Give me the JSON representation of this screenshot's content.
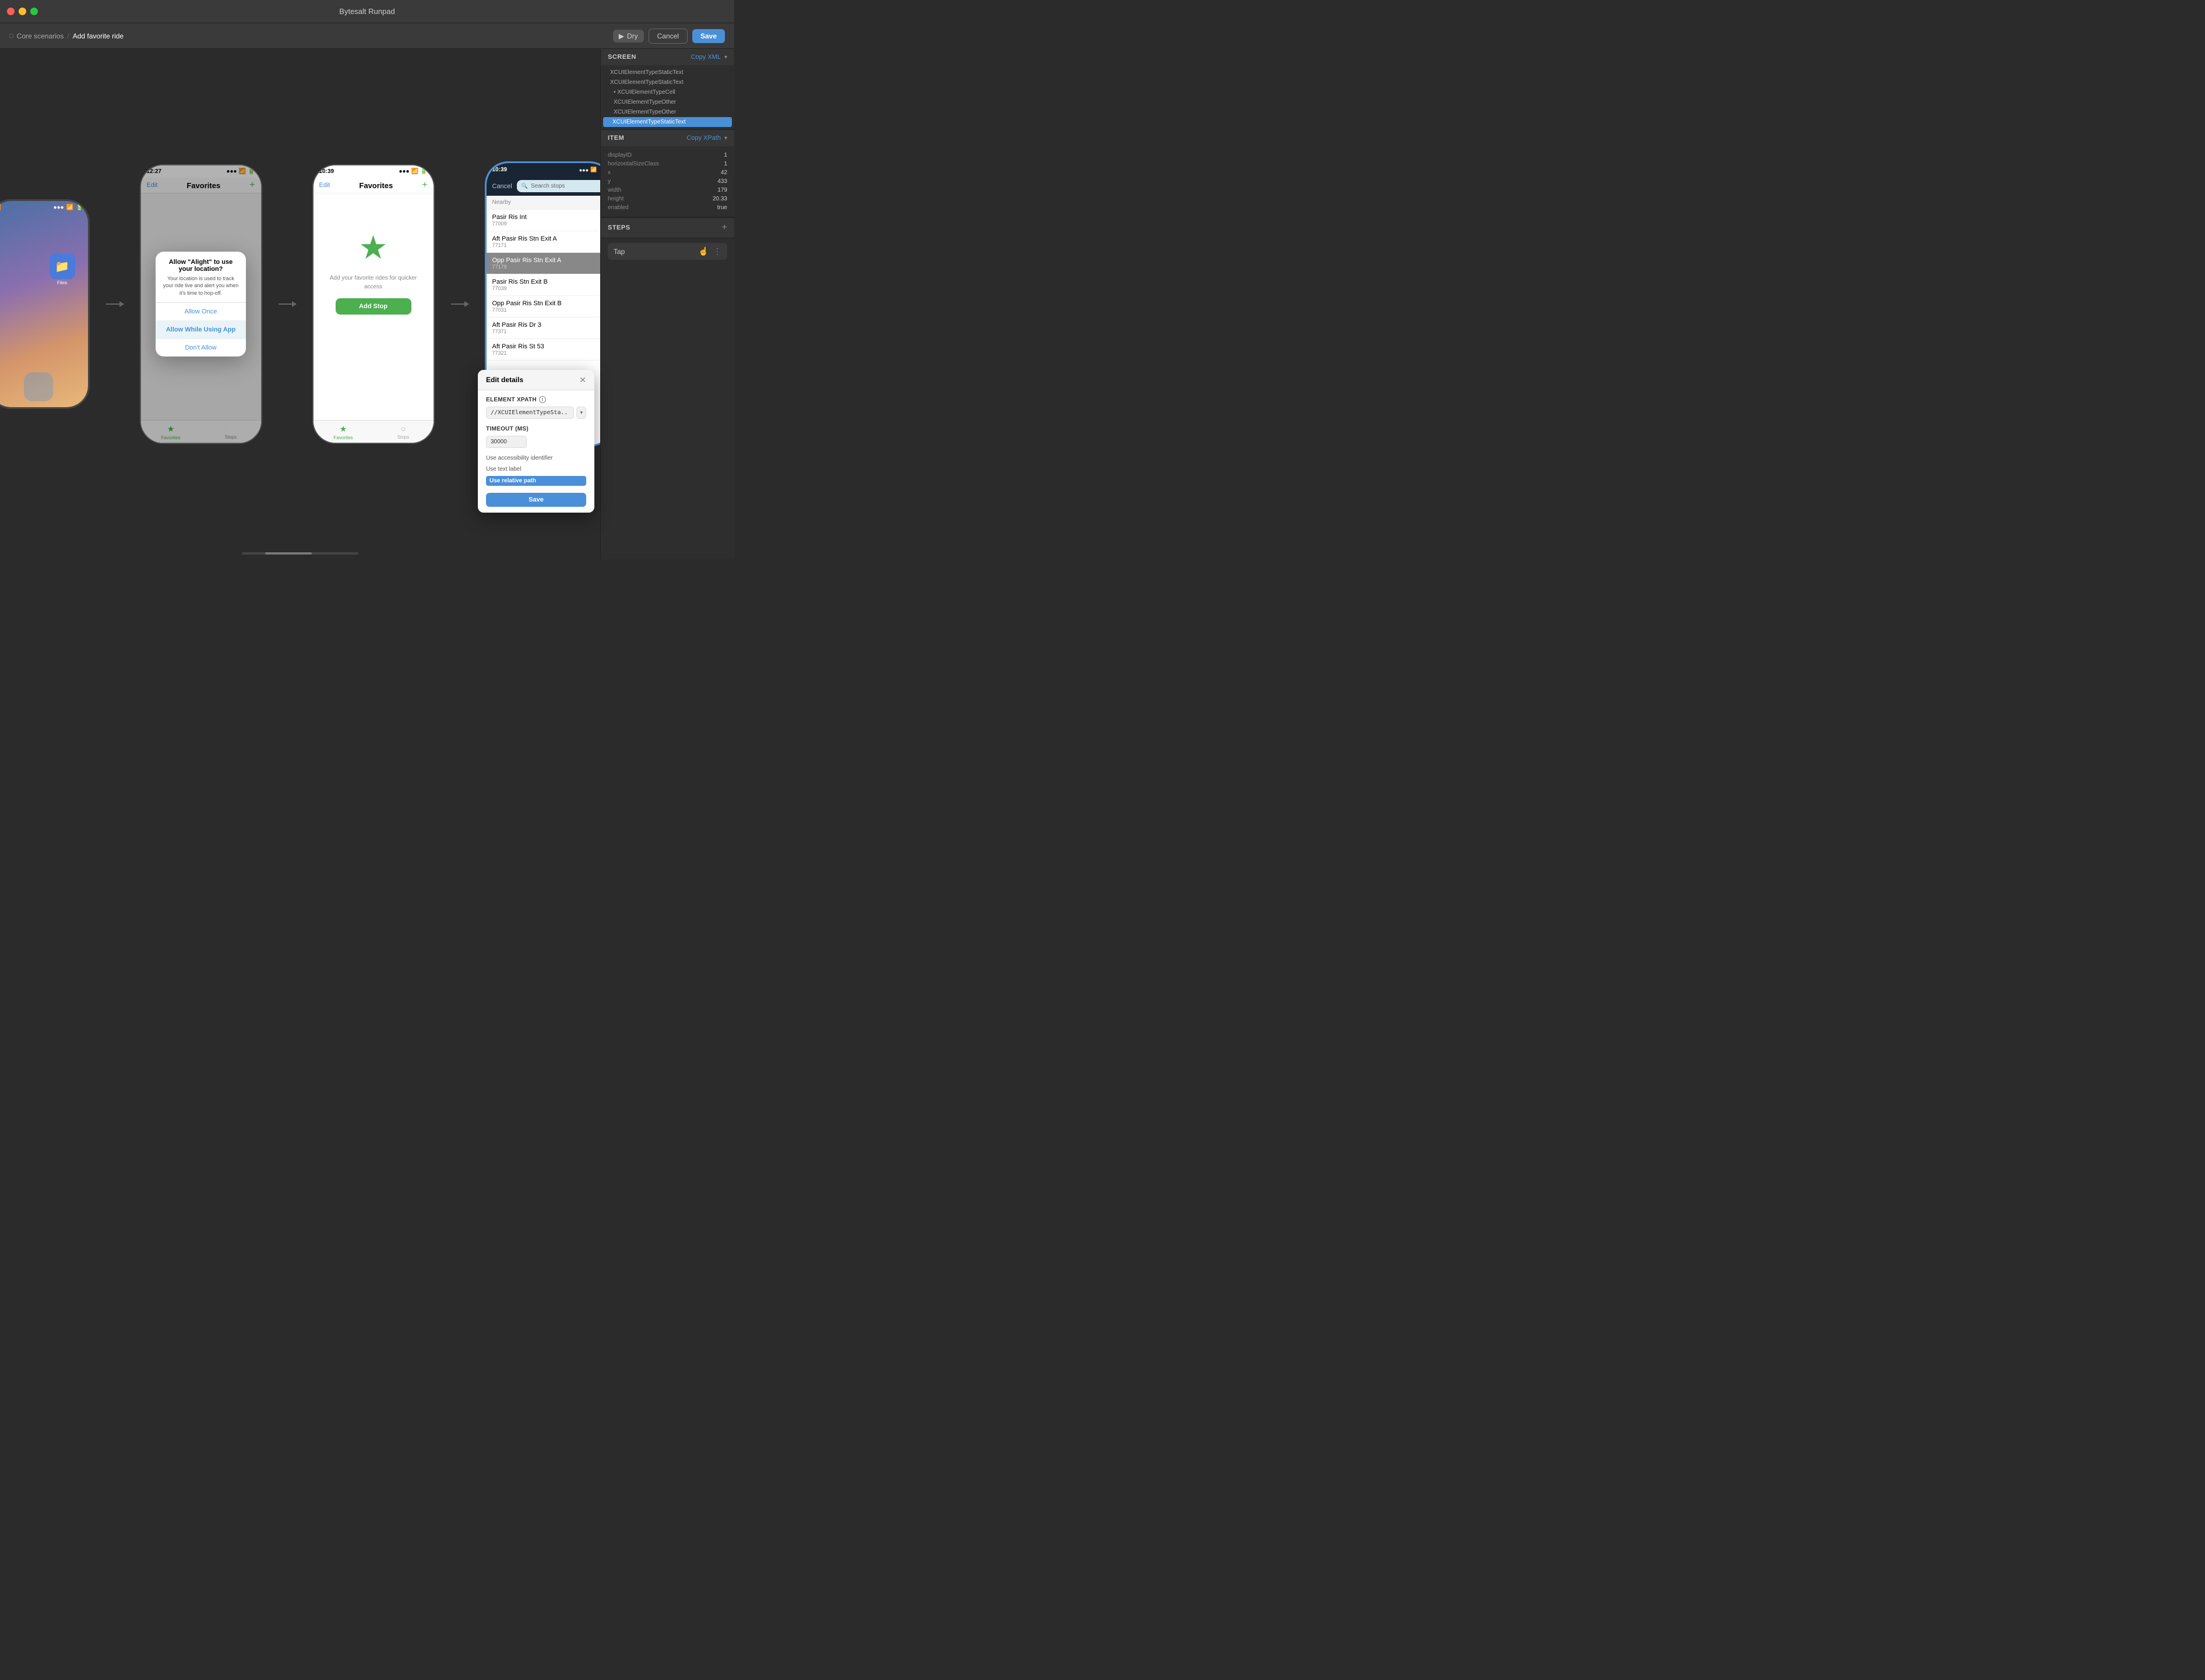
{
  "app": {
    "title": "Bytesalt Runpad"
  },
  "titlebar": {
    "title": "Bytesalt Runpad"
  },
  "toolbar": {
    "breadcrumb_parent": "Core scenarios",
    "breadcrumb_separator": "/",
    "breadcrumb_current": "Add favorite ride",
    "dry_label": "Dry",
    "cancel_label": "Cancel",
    "save_label": "Save"
  },
  "right_panel": {
    "screen_section": {
      "title": "SCREEN",
      "copy_xml_label": "Copy XML",
      "tree_items": [
        {
          "label": "XCUIElementTypeStaticText",
          "level": 0,
          "active": false
        },
        {
          "label": "XCUIElementTypeStaticText",
          "level": 0,
          "active": false
        },
        {
          "label": "• XCUIElementTypeCell",
          "level": 1,
          "active": false
        },
        {
          "label": "XCUIElementTypeOther",
          "level": 1,
          "active": false
        },
        {
          "label": "XCUIElementTypeOther",
          "level": 1,
          "active": false
        },
        {
          "label": "XCUIElementTypeStaticText",
          "level": 0,
          "active": true
        }
      ]
    },
    "item_section": {
      "title": "ITEM",
      "copy_xpath_label": "Copy XPath",
      "fields": [
        {
          "label": "displayID",
          "value": "1"
        },
        {
          "label": "horizontalSizeClass",
          "value": "1"
        },
        {
          "label": "x",
          "value": "42"
        },
        {
          "label": "y",
          "value": "433"
        },
        {
          "label": "width",
          "value": "179"
        },
        {
          "label": "height",
          "value": "20.33"
        },
        {
          "label": "enabled",
          "value": "true"
        }
      ]
    },
    "steps_section": {
      "title": "STEPS",
      "step_label": "Tap"
    }
  },
  "edit_details": {
    "title": "Edit details",
    "element_xpath_label": "ELEMENT XPATH",
    "xpath_value": "//XCUIElementTypeSta...",
    "timeout_label": "TIMEOUT (MS)",
    "timeout_value": "30000",
    "path_options": [
      {
        "label": "Use accessibility identifier",
        "active": false
      },
      {
        "label": "Use text label",
        "active": false
      },
      {
        "label": "Use relative path",
        "active": true
      }
    ],
    "save_label": "Save"
  },
  "phones": {
    "phone1": {
      "type": "home_screen",
      "app_icon": "📁",
      "app_label": "Files"
    },
    "phone2": {
      "type": "dialog",
      "time": "12:27",
      "nav_title": "Favorites",
      "nav_edit": "Edit",
      "nav_add": "+",
      "dialog_title": "Allow \"Alight\" to use your location?",
      "dialog_body": "Your location is used to track your ride live and alert you when it's time to hop-off.",
      "btn_allow_once": "Allow Once",
      "btn_allow_while": "Allow While Using App",
      "btn_dont_allow": "Don't Allow",
      "bottom_nav": [
        {
          "label": "Favorites",
          "active": true
        },
        {
          "label": "Stops",
          "active": false
        }
      ]
    },
    "phone3": {
      "type": "empty_favorites",
      "time": "10:39",
      "nav_title": "Favorites",
      "nav_edit": "Edit",
      "nav_add": "+",
      "empty_text": "Add your favorite rides\nfor quicker access",
      "add_stop_label": "Add Stop",
      "bottom_nav": [
        {
          "label": "Favorites",
          "active": true
        },
        {
          "label": "Stops",
          "active": false
        }
      ]
    },
    "phone4": {
      "type": "search",
      "time": "10:39",
      "cancel_label": "Cancel",
      "search_placeholder": "Search stops",
      "nearby_label": "Nearby",
      "stops": [
        {
          "name": "Pasir Ris Int",
          "code": "77009",
          "highlighted": false
        },
        {
          "name": "Aft Pasir Ris Stn Exit A",
          "code": "77171",
          "highlighted": false
        },
        {
          "name": "Opp Pasir Ris Stn Exit A",
          "code": "77179",
          "highlighted": true
        },
        {
          "name": "Pasir Ris Stn Exit B",
          "code": "77039",
          "highlighted": false
        },
        {
          "name": "Opp Pasir Ris Stn Exit B",
          "code": "77031",
          "highlighted": false
        },
        {
          "name": "Aft Pasir Ris Dr 3",
          "code": "77371",
          "highlighted": false
        },
        {
          "name": "Aft Pasir Ris St 53",
          "code": "77321",
          "highlighted": false
        }
      ]
    }
  }
}
